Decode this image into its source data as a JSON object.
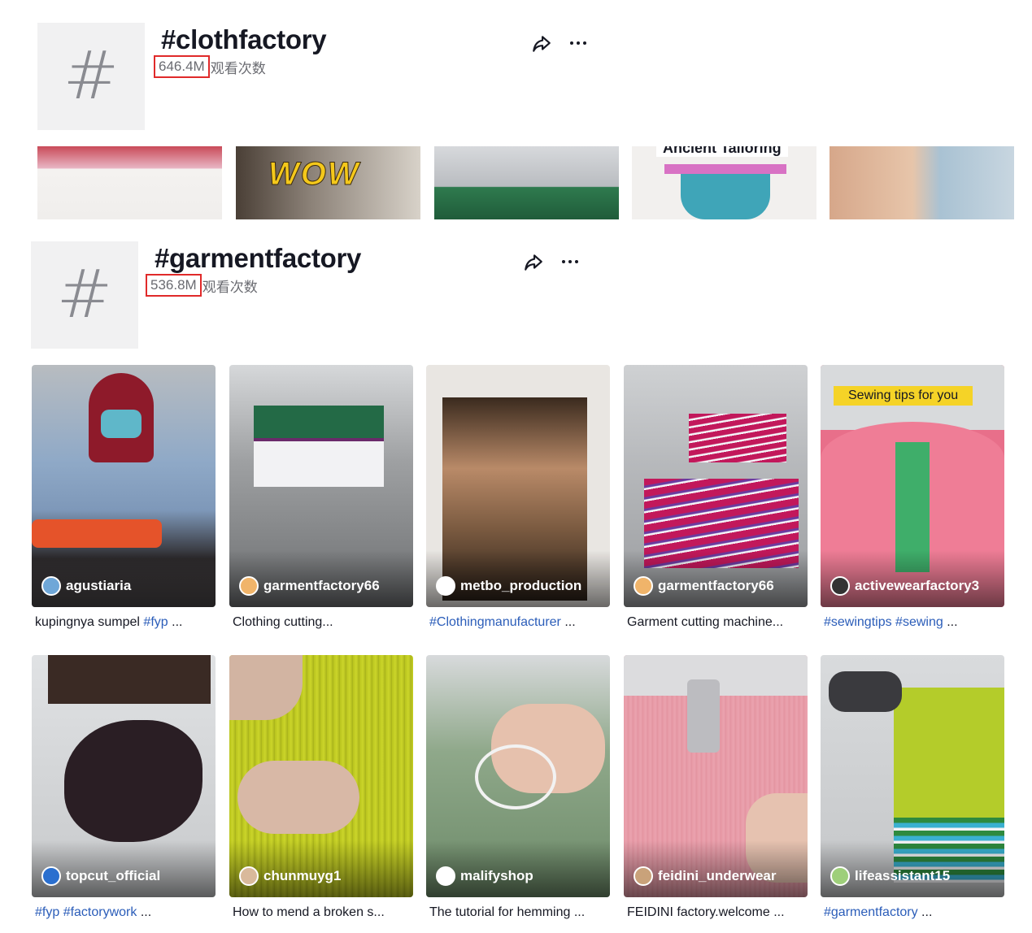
{
  "sections": [
    {
      "title": "#clothfactory",
      "views": "646.4M",
      "views_label": "观看次数",
      "strip_overlays": [
        "",
        "WOW",
        "",
        "Ancient Tailoring",
        ""
      ]
    },
    {
      "title": "#garmentfactory",
      "views": "536.8M",
      "views_label": "观看次数"
    }
  ],
  "hash_symbol": "#",
  "icons": {
    "share": "share-icon",
    "more": "more-icon"
  },
  "videos_row1": [
    {
      "author": "agustiaria",
      "caption_tag": "",
      "caption_text": "kupingnya sumpel ",
      "caption_tag2": "#fyp",
      "caption_tail": " ..."
    },
    {
      "author": "garmentfactory66",
      "caption_tag": "",
      "caption_text": "Clothing cutting...",
      "caption_tag2": "",
      "caption_tail": ""
    },
    {
      "author": "metbo_production",
      "caption_tag": "#Clothingmanufacturer",
      "caption_text": "",
      "caption_tag2": "",
      "caption_tail": " ..."
    },
    {
      "author": "garmentfactory66",
      "caption_tag": "",
      "caption_text": "Garment cutting machine...",
      "caption_tag2": "",
      "caption_tail": ""
    },
    {
      "author": "activewearfactory3",
      "caption_tag": "#sewingtips #sewing",
      "caption_text": "",
      "caption_tag2": "",
      "caption_tail": " ...",
      "banner": "Sewing tips for you"
    }
  ],
  "videos_row2": [
    {
      "author": "topcut_official",
      "caption_tag": "#fyp #factorywork",
      "caption_text": "",
      "caption_tail": " ..."
    },
    {
      "author": "chunmuyg1",
      "caption_tag": "",
      "caption_text": "How to mend a broken s...",
      "caption_tail": ""
    },
    {
      "author": "malifyshop",
      "caption_tag": "",
      "caption_text": "The tutorial for hemming ...",
      "caption_tail": ""
    },
    {
      "author": "feidini_underwear",
      "caption_tag": "",
      "caption_text": "FEIDINI factory.welcome ...",
      "caption_tail": ""
    },
    {
      "author": "lifeassistant15",
      "caption_tag": "#garmentfactory",
      "caption_text": "",
      "caption_tail": " ..."
    }
  ],
  "colors": {
    "highlight_box": "#e02a2a",
    "hashtag_link": "#2b5db9",
    "banner": "#f5d327"
  }
}
